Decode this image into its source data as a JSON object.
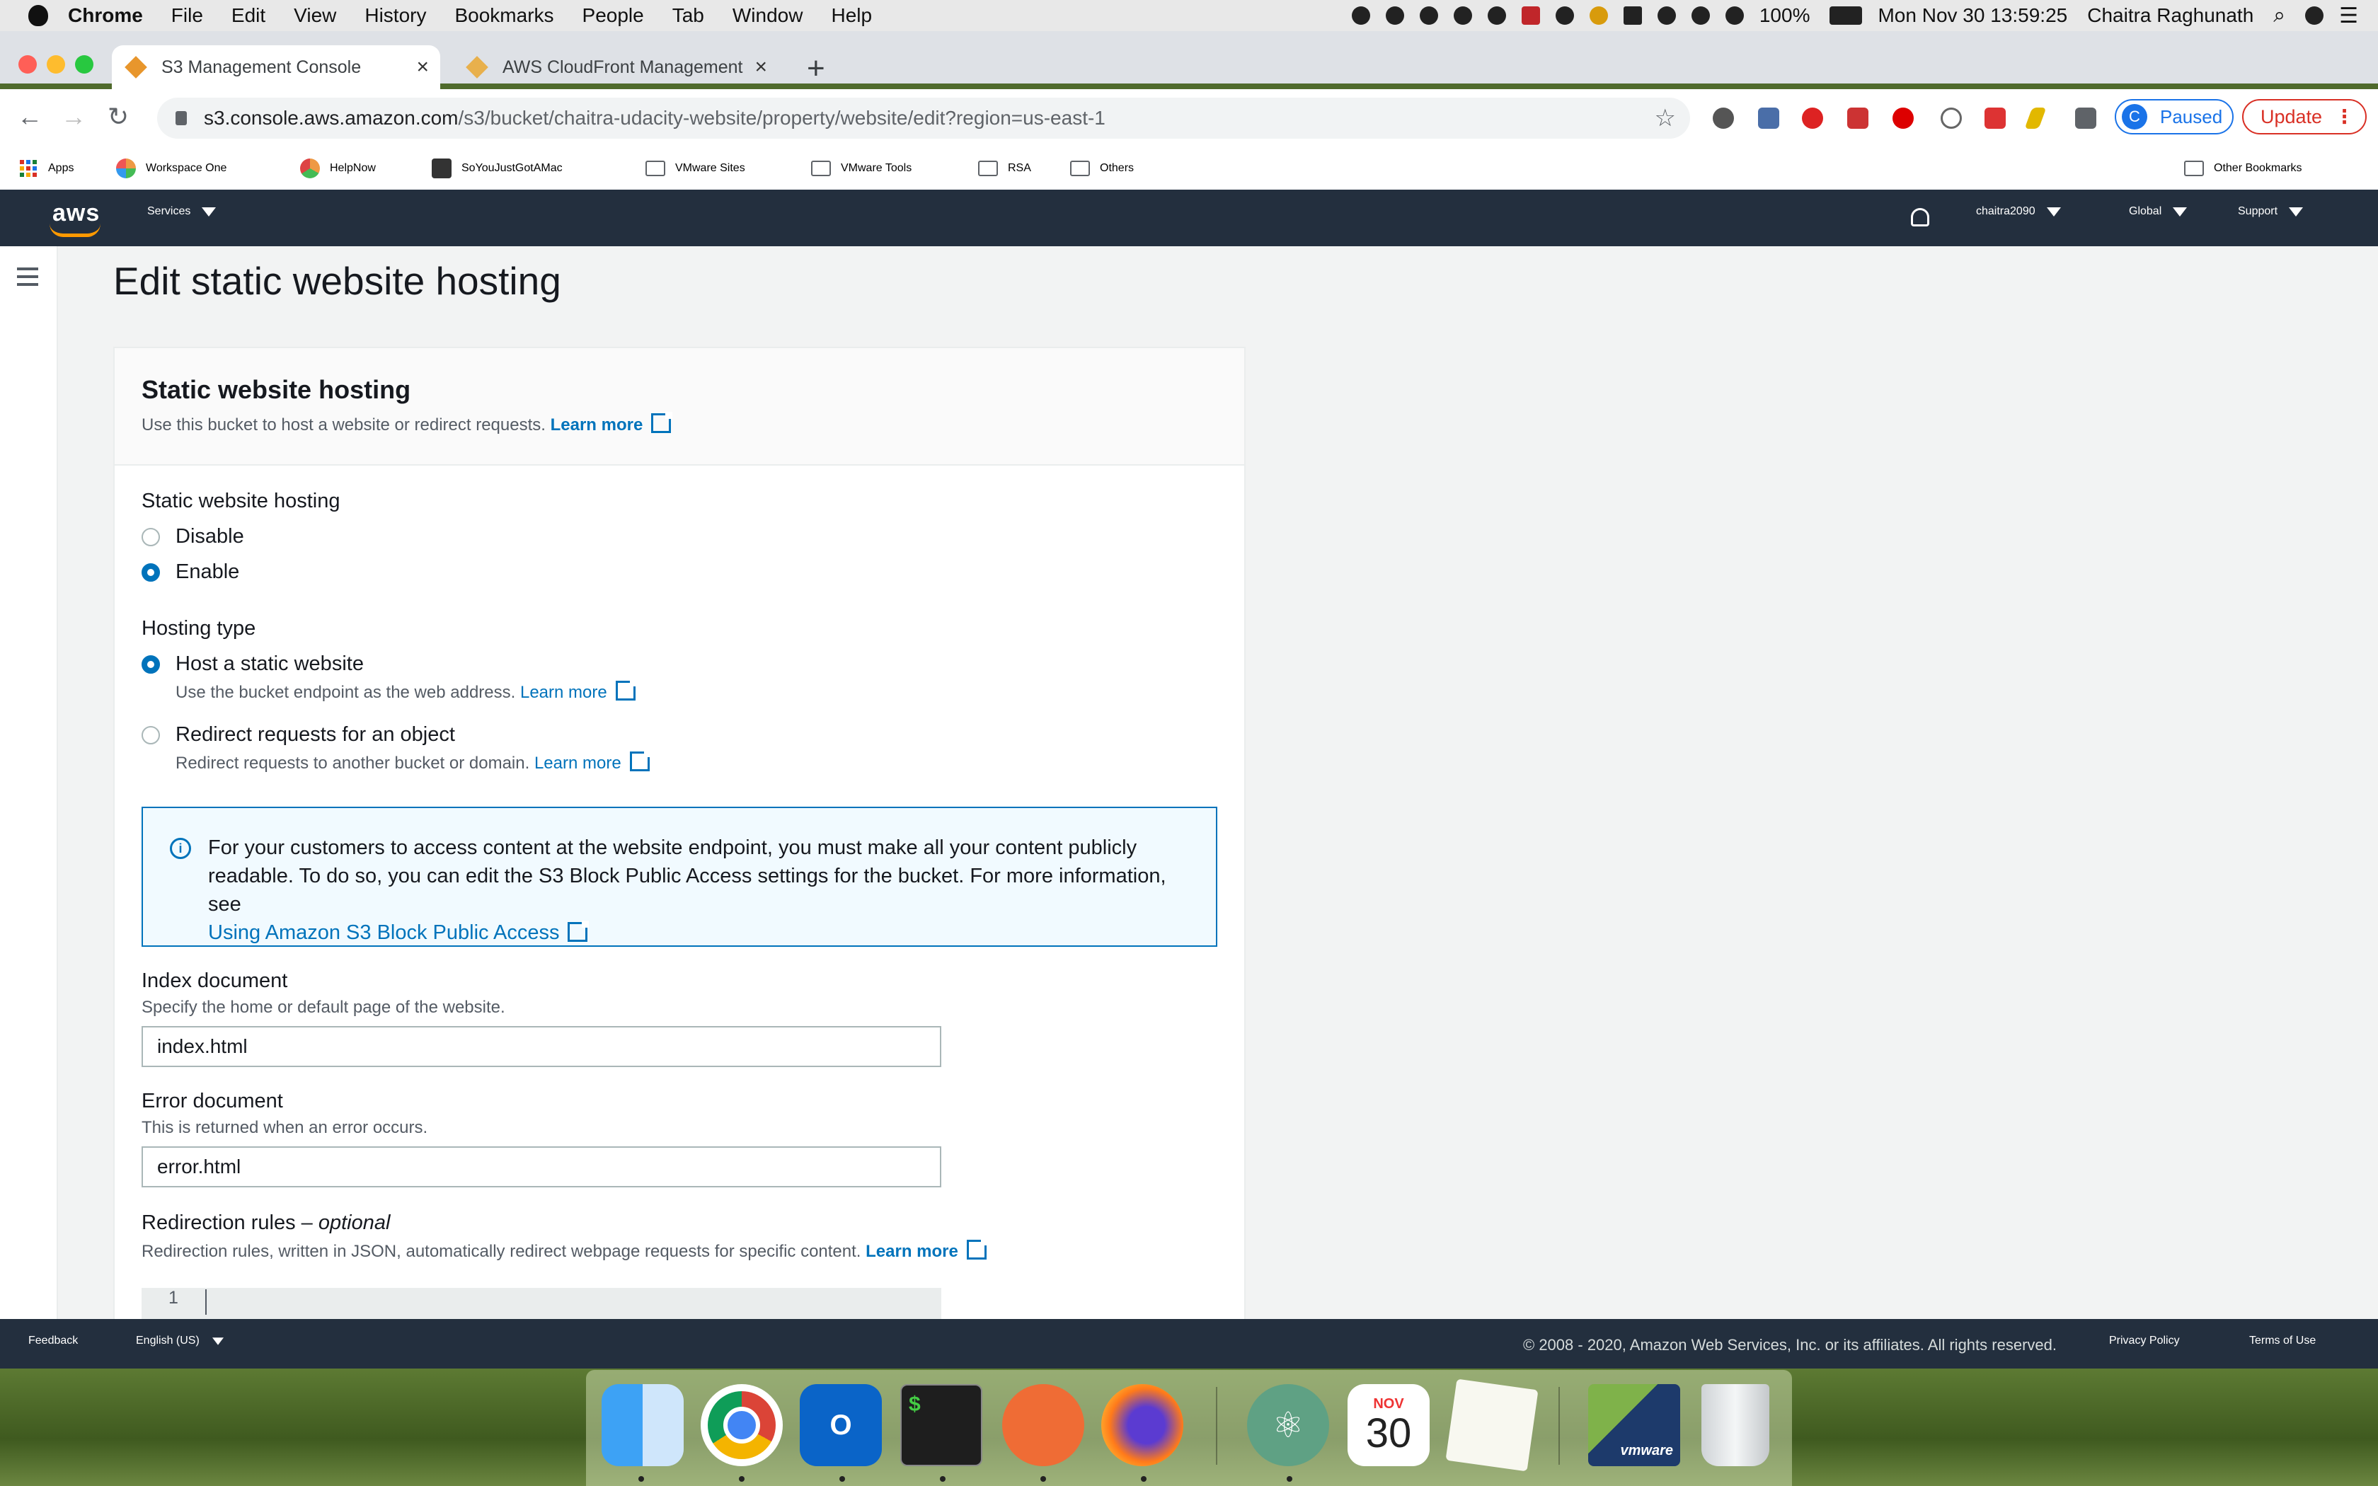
{
  "menubar": {
    "app": "Chrome",
    "items": [
      "File",
      "Edit",
      "View",
      "History",
      "Bookmarks",
      "People",
      "Tab",
      "Window",
      "Help"
    ],
    "battery": "100%",
    "datetime": "Mon Nov 30  13:59:25",
    "user": "Chaitra Raghunath"
  },
  "tabs": [
    {
      "title": "S3 Management Console",
      "active": true
    },
    {
      "title": "AWS CloudFront Management",
      "active": false
    }
  ],
  "address": {
    "host": "s3.console.aws.amazon.com",
    "path": "/s3/bucket/chaitra-udacity-website/property/website/edit?region=us-east-1"
  },
  "profile": {
    "initial": "C",
    "label": "Paused"
  },
  "update_label": "Update",
  "bookmarks": [
    "Apps",
    "Workspace One",
    "HelpNow",
    "SoYouJustGotAMac",
    "VMware Sites",
    "VMware Tools",
    "RSA",
    "Others"
  ],
  "other_bookmarks": "Other Bookmarks",
  "aws_nav": {
    "logo": "aws",
    "services": "Services",
    "account": "chaitra2090",
    "region": "Global",
    "support": "Support"
  },
  "page": {
    "title": "Edit static website hosting",
    "section_title": "Static website hosting",
    "section_desc": "Use this bucket to host a website or redirect requests.",
    "learn_more": "Learn more",
    "hosting_label": "Static website hosting",
    "hosting_options": [
      {
        "label": "Disable",
        "selected": false
      },
      {
        "label": "Enable",
        "selected": true
      }
    ],
    "hosting_type_label": "Hosting type",
    "hosting_types": [
      {
        "label": "Host a static website",
        "desc": "Use the bucket endpoint as the web address.",
        "selected": true
      },
      {
        "label": "Redirect requests for an object",
        "desc": "Redirect requests to another bucket or domain.",
        "selected": false
      }
    ],
    "info_text": "For your customers to access content at the website endpoint, you must make all your content publicly readable. To do so, you can edit the S3 Block Public Access settings for the bucket. For more information, see",
    "info_link": "Using Amazon S3 Block Public Access",
    "index_label": "Index document",
    "index_desc": "Specify the home or default page of the website.",
    "index_value": "index.html",
    "error_label": "Error document",
    "error_desc": "This is returned when an error occurs.",
    "error_value": "error.html",
    "redirect_label": "Redirection rules – ",
    "redirect_optional": "optional",
    "redirect_desc": "Redirection rules, written in JSON, automatically redirect webpage requests for specific content.",
    "editor_line": "1"
  },
  "footer": {
    "feedback": "Feedback",
    "language": "English (US)",
    "copyright": "© 2008 - 2020, Amazon Web Services, Inc. or its affiliates. All rights reserved.",
    "privacy": "Privacy Policy",
    "terms": "Terms of Use"
  },
  "dock": {
    "calendar_month": "NOV",
    "calendar_day": "30",
    "vmware": "vmware",
    "apps": [
      "finder-icon",
      "chrome-icon",
      "outlook-icon",
      "terminal-icon",
      "postman-icon",
      "firefox-icon",
      "atom-icon",
      "calendar-icon",
      "textedit-icon",
      "vmware-icon",
      "trash-icon"
    ]
  },
  "colors": {
    "aws_nav": "#232f3e",
    "aws_orange": "#ff9900",
    "link": "#0073bb",
    "info_bg": "#f1faff"
  }
}
